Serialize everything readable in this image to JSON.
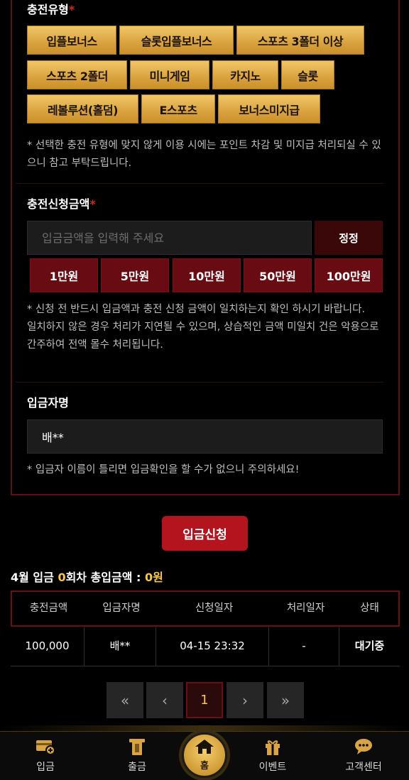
{
  "charge_type": {
    "label": "충전유형",
    "required_mark": "*",
    "options": [
      "입플보너스",
      "슬롯입플보너스",
      "스포츠 3폴더 이상",
      "스포츠 2폴더",
      "미니게임",
      "카지노",
      "슬롯",
      "레볼루션(홀덤)",
      "E스포츠",
      "보너스미지급"
    ],
    "notice": "* 선택한 충전 유형에 맞지 않게 이용 시에는 포인트 차감 및 미지급 처리되실 수 있으니 참고 부탁드립니다."
  },
  "amount": {
    "label": "충전신청금액",
    "required_mark": "*",
    "placeholder": "입금금액을 입력해 주세요",
    "value": "",
    "reset_label": "정정",
    "quick_buttons": [
      "1만원",
      "5만원",
      "10만원",
      "50만원",
      "100만원"
    ],
    "notice_line1": "* 신청 전 반드시 입금액과 충전 신청 금액이 일치하는지 확인 하시기 바랍니다.",
    "notice_line2": "일치하지 않은 경우 처리가 지연될 수 있으며, 상습적인 금액 미일치 건은 악용으로 간주하여 전액 몰수 처리됩니다."
  },
  "depositor": {
    "label": "입금자명",
    "value": "배**",
    "notice": "* 입금자 이름이 틀리면 입금확인을 할 수가 없으니 주의하세요!"
  },
  "submit_label": "입금신청",
  "summary": {
    "prefix": "4월 입금 ",
    "count": "0",
    "middle": "회차 총입금액 : ",
    "total": "0원"
  },
  "table": {
    "headers": [
      "충전금액",
      "입금자명",
      "신청일자",
      "처리일자",
      "상태"
    ],
    "rows": [
      [
        "100,000",
        "배**",
        "04-15 23:32",
        "-",
        "대기중"
      ]
    ]
  },
  "pagination": {
    "first": "«",
    "prev": "‹",
    "current": "1",
    "next": "›",
    "last": "»"
  },
  "bottom_nav": {
    "deposit": "입금",
    "withdraw": "출금",
    "home": "홈",
    "event": "이벤트",
    "support": "고객센터"
  },
  "colors": {
    "gold": "#dba542",
    "accent_red": "#b3141e",
    "highlight_yellow": "#f5c74f"
  }
}
